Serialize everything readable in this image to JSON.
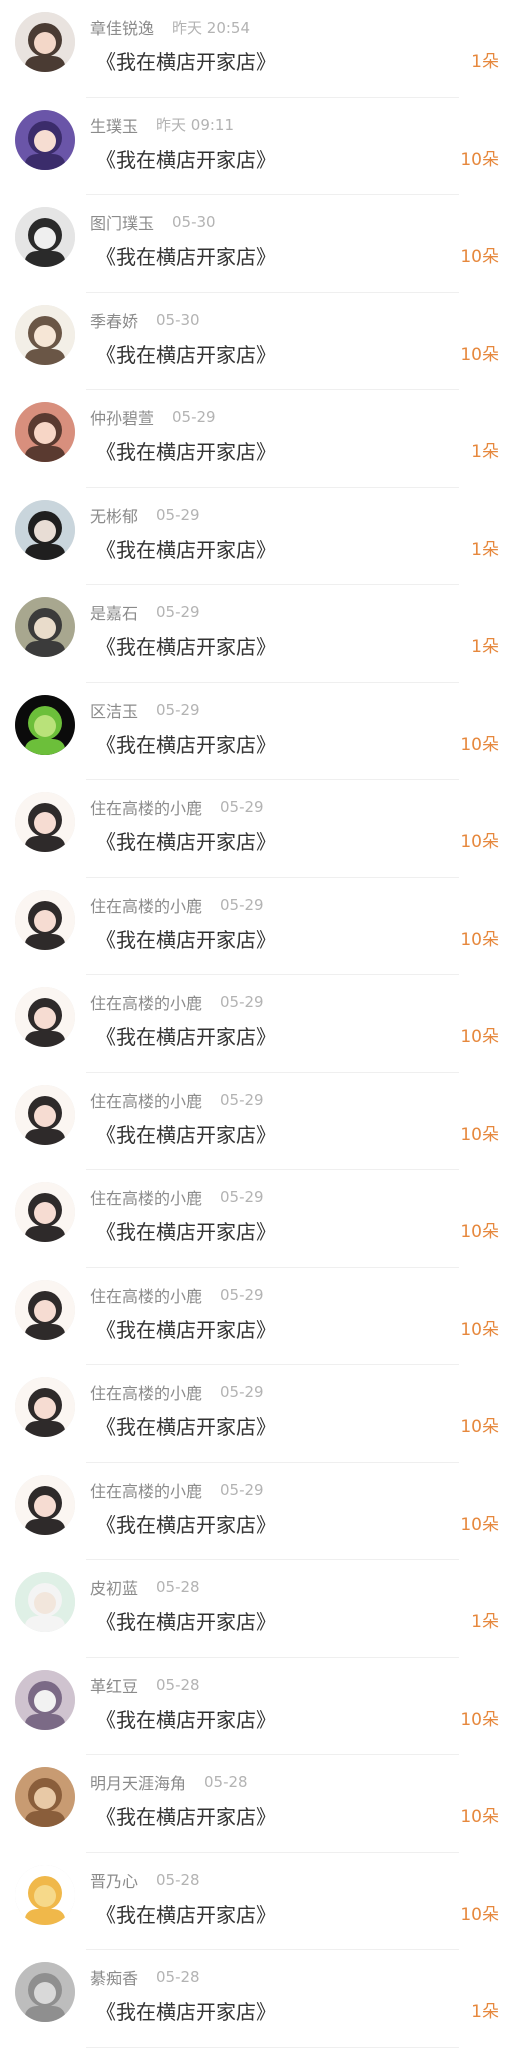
{
  "accent_color": "#e6883d",
  "gifts": [
    {
      "name": "章佳锐逸",
      "time": "昨天 20:54",
      "title": "《我在横店开家店》",
      "amount": "1朵",
      "avatar": "avatar-girl-icon",
      "bg": "#e9e3df",
      "skin": "#f3d7c8",
      "hair": "#4a3b33"
    },
    {
      "name": "生璞玉",
      "time": "昨天 09:11",
      "title": "《我在横店开家店》",
      "amount": "10朵",
      "avatar": "avatar-anime-girl-icon",
      "bg": "#6a55a8",
      "skin": "#f6ddd2",
      "hair": "#3b2c6b"
    },
    {
      "name": "图门璞玉",
      "time": "05-30",
      "title": "《我在横店开家店》",
      "amount": "10朵",
      "avatar": "avatar-sunglasses-icon",
      "bg": "#e5e5e5",
      "skin": "#efefef",
      "hair": "#2a2a2a"
    },
    {
      "name": "季春娇",
      "time": "05-30",
      "title": "《我在横店开家店》",
      "amount": "10朵",
      "avatar": "avatar-sketch-girl-icon",
      "bg": "#f3efe7",
      "skin": "#f6e6d6",
      "hair": "#6a5646"
    },
    {
      "name": "仲孙碧萱",
      "time": "05-29",
      "title": "《我在横店开家店》",
      "amount": "1朵",
      "avatar": "avatar-girl-icon",
      "bg": "#d88f7d",
      "skin": "#f7d6c6",
      "hair": "#5a3a30"
    },
    {
      "name": "无彬郁",
      "time": "05-29",
      "title": "《我在横店开家店》",
      "amount": "1朵",
      "avatar": "avatar-dark-hair-icon",
      "bg": "#c9d5dc",
      "skin": "#e8ddd5",
      "hair": "#1f1f1f"
    },
    {
      "name": "是嘉石",
      "time": "05-29",
      "title": "《我在横店开家店》",
      "amount": "1朵",
      "avatar": "avatar-photo-icon",
      "bg": "#a8a78f",
      "skin": "#e9dccb",
      "hair": "#3b3b3b"
    },
    {
      "name": "区洁玉",
      "time": "05-29",
      "title": "《我在横店开家店》",
      "amount": "10朵",
      "avatar": "avatar-flower-icon",
      "bg": "#0b0b0b",
      "skin": "#b9e27a",
      "hair": "#6cbf3a"
    },
    {
      "name": "住在高楼的小鹿",
      "time": "05-29",
      "title": "《我在横店开家店》",
      "amount": "10朵",
      "avatar": "avatar-deer-girl-icon",
      "bg": "#fbf6f2",
      "skin": "#f6dcd2",
      "hair": "#2e2a2a"
    },
    {
      "name": "住在高楼的小鹿",
      "time": "05-29",
      "title": "《我在横店开家店》",
      "amount": "10朵",
      "avatar": "avatar-deer-girl-icon",
      "bg": "#fbf6f2",
      "skin": "#f6dcd2",
      "hair": "#2e2a2a"
    },
    {
      "name": "住在高楼的小鹿",
      "time": "05-29",
      "title": "《我在横店开家店》",
      "amount": "10朵",
      "avatar": "avatar-deer-girl-icon",
      "bg": "#fbf6f2",
      "skin": "#f6dcd2",
      "hair": "#2e2a2a"
    },
    {
      "name": "住在高楼的小鹿",
      "time": "05-29",
      "title": "《我在横店开家店》",
      "amount": "10朵",
      "avatar": "avatar-deer-girl-icon",
      "bg": "#fbf6f2",
      "skin": "#f6dcd2",
      "hair": "#2e2a2a"
    },
    {
      "name": "住在高楼的小鹿",
      "time": "05-29",
      "title": "《我在横店开家店》",
      "amount": "10朵",
      "avatar": "avatar-deer-girl-icon",
      "bg": "#fbf6f2",
      "skin": "#f6dcd2",
      "hair": "#2e2a2a"
    },
    {
      "name": "住在高楼的小鹿",
      "time": "05-29",
      "title": "《我在横店开家店》",
      "amount": "10朵",
      "avatar": "avatar-deer-girl-icon",
      "bg": "#fbf6f2",
      "skin": "#f6dcd2",
      "hair": "#2e2a2a"
    },
    {
      "name": "住在高楼的小鹿",
      "time": "05-29",
      "title": "《我在横店开家店》",
      "amount": "10朵",
      "avatar": "avatar-deer-girl-icon",
      "bg": "#fbf6f2",
      "skin": "#f6dcd2",
      "hair": "#2e2a2a"
    },
    {
      "name": "住在高楼的小鹿",
      "time": "05-29",
      "title": "《我在横店开家店》",
      "amount": "10朵",
      "avatar": "avatar-deer-girl-icon",
      "bg": "#fbf6f2",
      "skin": "#f6dcd2",
      "hair": "#2e2a2a"
    },
    {
      "name": "皮初蓝",
      "time": "05-28",
      "title": "《我在横店开家店》",
      "amount": "1朵",
      "avatar": "avatar-white-hair-icon",
      "bg": "#dff0e6",
      "skin": "#f2e6dc",
      "hair": "#f4f4f4"
    },
    {
      "name": "革红豆",
      "time": "05-28",
      "title": "《我在横店开家店》",
      "amount": "10朵",
      "avatar": "avatar-clock-icon",
      "bg": "#cfc3cf",
      "skin": "#f2f2f2",
      "hair": "#7b6a86"
    },
    {
      "name": "明月天涯海角",
      "time": "05-28",
      "title": "《我在横店开家店》",
      "amount": "10朵",
      "avatar": "avatar-cat-icon",
      "bg": "#c89b72",
      "skin": "#e8c9a6",
      "hair": "#8a5e3b"
    },
    {
      "name": "晋乃心",
      "time": "05-28",
      "title": "《我在横店开家店》",
      "amount": "10朵",
      "avatar": "avatar-small-emoji-icon",
      "bg": "#ffffff",
      "skin": "#f6d98a",
      "hair": "#f0b84a"
    },
    {
      "name": "綦痴香",
      "time": "05-28",
      "title": "《我在横店开家店》",
      "amount": "1朵",
      "avatar": "avatar-blur-photo-icon",
      "bg": "#bdbdbd",
      "skin": "#d9d9d9",
      "hair": "#8f8f8f"
    }
  ]
}
